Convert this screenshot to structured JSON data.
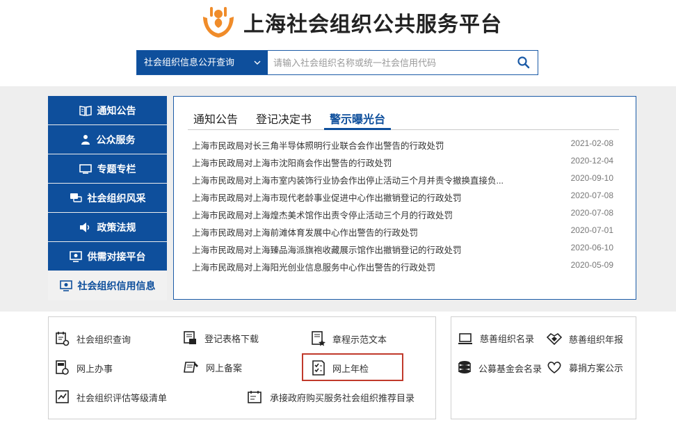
{
  "site": {
    "title": "上海社会组织公共服务平台"
  },
  "search": {
    "scope_label": "社会组织信息公开查询",
    "placeholder": "请输入社会组织名称或统一社会信用代码"
  },
  "sidebar": {
    "items": [
      {
        "label": "通知公告",
        "icon": "book-icon"
      },
      {
        "label": "公众服务",
        "icon": "person-icon"
      },
      {
        "label": "专题专栏",
        "icon": "monitor-icon"
      },
      {
        "label": "社会组织风采",
        "icon": "chat-icon"
      },
      {
        "label": "政策法规",
        "icon": "speaker-icon"
      },
      {
        "label": "供需对接平台",
        "icon": "screen-icon"
      },
      {
        "label": "社会组织信用信息",
        "icon": "screen-icon"
      }
    ]
  },
  "panel": {
    "tabs": [
      {
        "label": "通知公告"
      },
      {
        "label": "登记决定书"
      },
      {
        "label": "警示曝光台"
      }
    ],
    "news": [
      {
        "title": "上海市民政局对长三角半导体照明行业联合会作出警告的行政处罚",
        "date": "2021-02-08"
      },
      {
        "title": "上海市民政局对上海市沈阳商会作出警告的行政处罚",
        "date": "2020-12-04"
      },
      {
        "title": "上海市民政局对上海市室内装饰行业协会作出停止活动三个月并责令撤换直接负...",
        "date": "2020-09-10"
      },
      {
        "title": "上海市民政局对上海市现代老龄事业促进中心作出撤销登记的行政处罚",
        "date": "2020-07-08"
      },
      {
        "title": "上海市民政局对上海煌杰美术馆作出责令停止活动三个月的行政处罚",
        "date": "2020-07-08"
      },
      {
        "title": "上海市民政局对上海前滩体育发展中心作出警告的行政处罚",
        "date": "2020-07-01"
      },
      {
        "title": "上海市民政局对上海臻品海派旗袍收藏展示馆作出撤销登记的行政处罚",
        "date": "2020-06-10"
      },
      {
        "title": "上海市民政局对上海阳光创业信息服务中心作出警告的行政处罚",
        "date": "2020-05-09"
      }
    ]
  },
  "services": {
    "org_query": "社会组织查询",
    "form_download": "登记表格下载",
    "charter_template": "章程示范文本",
    "online_affairs": "网上办事",
    "online_filing": "网上备案",
    "annual_inspection": "网上年检",
    "rating_list": "社会组织评估等级清单",
    "gov_purchase": "承接政府购买服务社会组织推荐目录"
  },
  "charity": {
    "charity_list": "慈善组织名录",
    "charity_annual": "慈善组织年报",
    "foundation_list": "公募基金会名录",
    "fundraising_plan": "募捐方案公示"
  },
  "colors": {
    "brand_blue": "#0e4f9c",
    "logo_orange": "#f08c2a",
    "highlight_red": "#c0392b",
    "band_gray": "#eeeeee"
  }
}
